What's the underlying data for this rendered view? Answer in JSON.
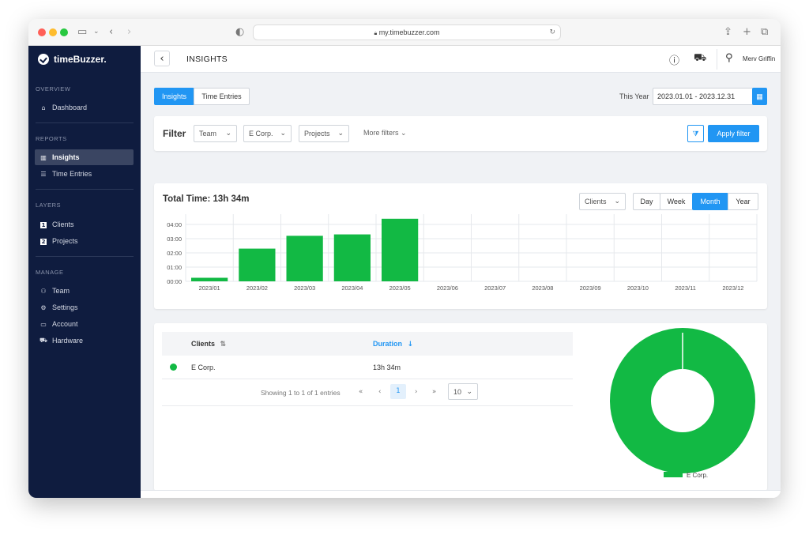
{
  "browser": {
    "url": "my.timebuzzer.com",
    "traffic_lights": [
      "#ff5f57",
      "#febc2e",
      "#28c840"
    ]
  },
  "sidebar": {
    "brand": "timeBuzzer.",
    "sections": [
      {
        "title": "OVERVIEW",
        "items": [
          {
            "label": "Dashboard",
            "icon": "dashboard-icon"
          }
        ]
      },
      {
        "title": "REPORTS",
        "items": [
          {
            "label": "Insights",
            "icon": "bar-chart-icon",
            "active": true
          },
          {
            "label": "Time Entries",
            "icon": "list-icon"
          }
        ]
      },
      {
        "title": "LAYERS",
        "items": [
          {
            "label": "Clients",
            "icon": "layer-1-icon"
          },
          {
            "label": "Projects",
            "icon": "layer-2-icon"
          }
        ]
      },
      {
        "title": "MANAGE",
        "items": [
          {
            "label": "Team",
            "icon": "team-icon"
          },
          {
            "label": "Settings",
            "icon": "gear-icon"
          },
          {
            "label": "Account",
            "icon": "card-icon"
          },
          {
            "label": "Hardware",
            "icon": "cart-icon"
          }
        ]
      }
    ]
  },
  "header": {
    "title": "INSIGHTS",
    "user_name": "Merv Griffin"
  },
  "tabs": [
    {
      "label": "Insights",
      "active": true
    },
    {
      "label": "Time Entries",
      "active": false
    }
  ],
  "date_range": {
    "label": "This Year",
    "value": "2023.01.01 - 2023.12.31"
  },
  "filter": {
    "title": "Filter",
    "dropdowns": [
      "Team",
      "E Corp.",
      "Projects"
    ],
    "more_filters": "More filters",
    "apply_label": "Apply filter"
  },
  "chart_card": {
    "title": "Total Time: 13h 34m",
    "group_by": "Clients",
    "periods": [
      {
        "label": "Day"
      },
      {
        "label": "Week"
      },
      {
        "label": "Month",
        "active": true
      },
      {
        "label": "Year"
      }
    ]
  },
  "chart_data": {
    "type": "bar",
    "categories": [
      "2023/01",
      "2023/02",
      "2023/03",
      "2023/04",
      "2023/05",
      "2023/06",
      "2023/07",
      "2023/08",
      "2023/09",
      "2023/10",
      "2023/11",
      "2023/12"
    ],
    "values": [
      0.25,
      2.3,
      3.2,
      3.3,
      4.4,
      0,
      0,
      0,
      0,
      0,
      0,
      0
    ],
    "yticks": [
      "00:00",
      "01:00",
      "02:00",
      "03:00",
      "04:00"
    ],
    "ylim": [
      0,
      4.5
    ],
    "color": "#12b944",
    "grid": true
  },
  "table": {
    "columns": [
      "Clients",
      "Duration"
    ],
    "rows": [
      {
        "client": "E Corp.",
        "duration": "13h 34m",
        "color": "#12b944"
      }
    ],
    "showing": "Showing 1 to 1 of 1 entries",
    "pager": {
      "first": "«",
      "prev": "‹",
      "page": "1",
      "next": "›",
      "last": "»"
    },
    "page_size": "10"
  },
  "donut": {
    "slices": [
      {
        "name": "E Corp.",
        "value": 100,
        "color": "#12b944"
      }
    ],
    "legend": "E Corp."
  }
}
